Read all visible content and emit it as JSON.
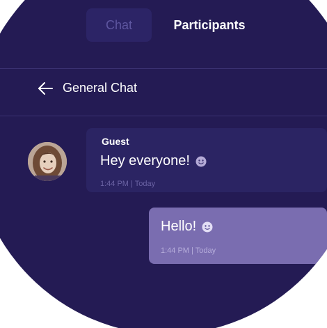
{
  "tabs": [
    {
      "label": "Chat",
      "active": false
    },
    {
      "label": "Participants",
      "active": true
    }
  ],
  "header": {
    "back_icon": "arrow-left-icon",
    "title": "General Chat"
  },
  "messages": [
    {
      "sender": "Guest",
      "text": "Hey everyone!",
      "emoji_icon": "smiling-face-icon",
      "time": "1:44 PM | Today",
      "avatar": "guest-avatar"
    },
    {
      "sender": "",
      "text": "Hello!",
      "emoji_icon": "smiling-face-icon",
      "time": "1:44 PM | Today"
    }
  ],
  "colors": {
    "background": "#241b54",
    "guest_bubble": "#2b2463",
    "own_bubble": "#7a6db0",
    "text": "#ffffff"
  }
}
